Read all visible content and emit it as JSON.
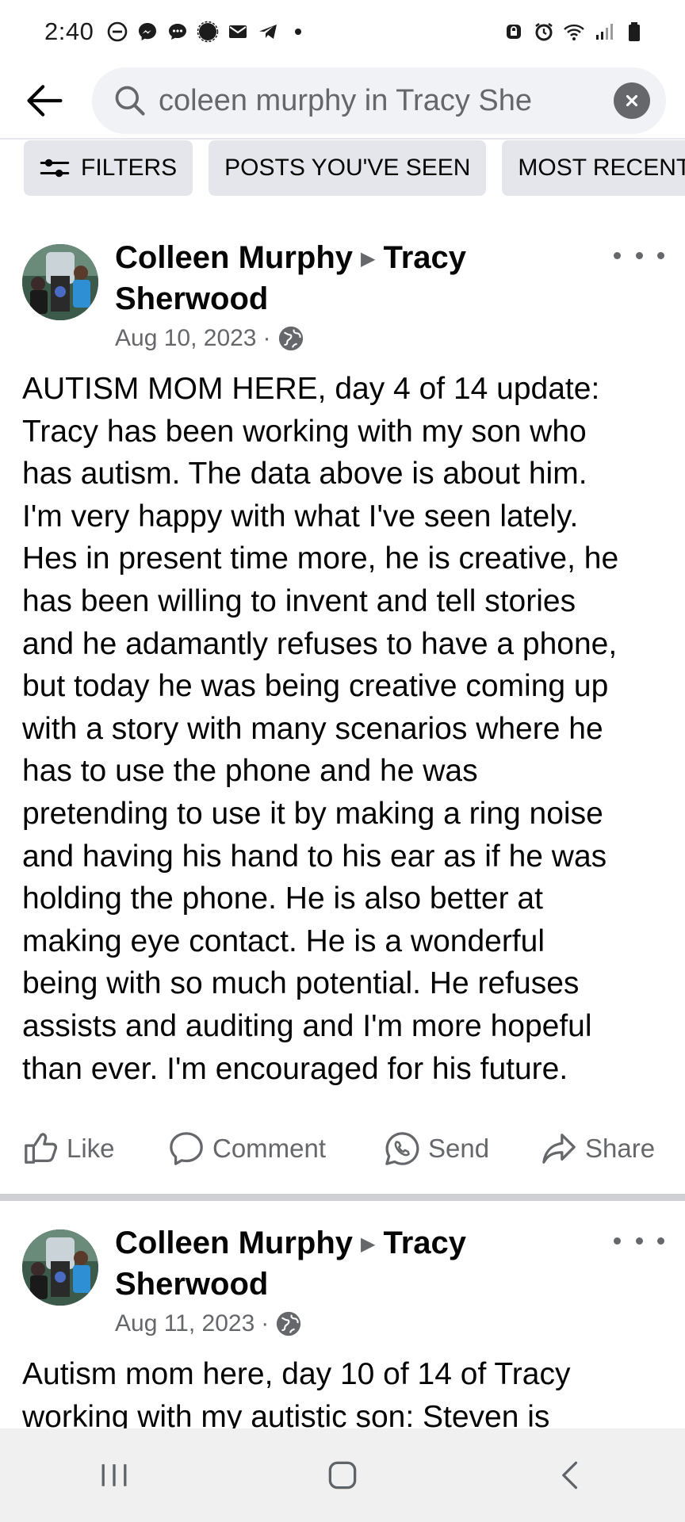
{
  "status_bar": {
    "time": "2:40",
    "left_icons": [
      "do-not-disturb-icon",
      "messenger-icon",
      "chat-icon",
      "circle-badge-icon",
      "mail-icon",
      "telegram-icon",
      "dot-icon"
    ],
    "right_icons": [
      "lock-icon",
      "alarm-icon",
      "wifi-icon",
      "signal-icon",
      "battery-icon"
    ]
  },
  "search": {
    "query": "coleen murphy in Tracy She"
  },
  "filters": [
    {
      "label": "FILTERS",
      "icon": "sliders-icon"
    },
    {
      "label": "POSTS YOU'VE SEEN"
    },
    {
      "label": "MOST RECENT"
    }
  ],
  "posts": [
    {
      "author": "Colleen Murphy",
      "recipient": "Tracy Sherwood",
      "date": "Aug 10, 2023",
      "privacy": "·",
      "text": "AUTISM MOM HERE, day 4 of 14 update:\nTracy has been working with my son who\nhas autism.  The data above is about him.\nI'm very happy with what I've seen lately.\nHes in present time more, he is creative, he\nhas been willing to invent and tell stories\nand he adamantly refuses to have a phone,\nbut today he was being creative coming up\nwith a story with many scenarios where he\nhas to use the phone and he was\npretending to use it by making a ring noise\nand having his hand to his ear as if he was\nholding the phone.  He is also better at\nmaking eye contact.  He is a wonderful\nbeing with so much potential.  He refuses\nassists and auditing and I'm more hopeful\nthan ever.   I'm encouraged for his future.",
      "actions": {
        "like": "Like",
        "comment": "Comment",
        "send": "Send",
        "share": "Share"
      }
    },
    {
      "author": "Colleen Murphy",
      "recipient": "Tracy Sherwood",
      "date": "Aug 11, 2023",
      "privacy": "·",
      "text": "Autism mom here, day 10 of 14 of Tracy\nworking with my autistic son:  Steven is"
    }
  ],
  "colors": {
    "text_primary": "#050505",
    "text_secondary": "#65676b",
    "chip_bg": "#e4e6eb",
    "search_bg": "#f0f2f5",
    "divider": "#ced0d4"
  }
}
